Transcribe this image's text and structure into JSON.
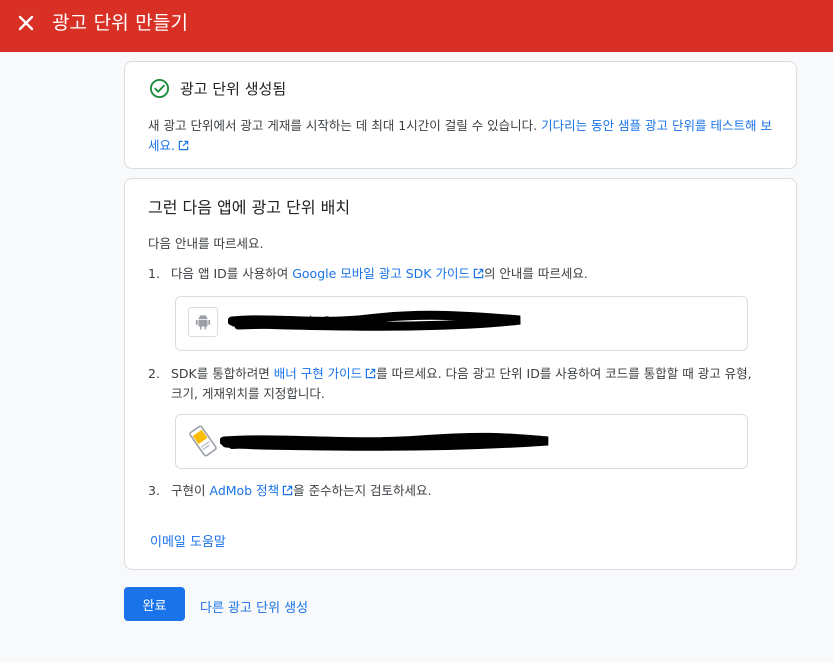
{
  "header": {
    "title": "광고 단위 만들기",
    "close_icon": "close-icon",
    "bg_color": "#d93025"
  },
  "created_card": {
    "status_icon": "check-circle-icon",
    "title": "광고 단위 생성됨",
    "body_text": "새 광고 단위에서 광고 게재를 시작하는 데 최대 1시간이 걸릴 수 있습니다. ",
    "body_link": "기다리는 동안 샘플 광고 단위를 테스트해 보세요."
  },
  "place_card": {
    "title": "그런 다음 앱에 광고 단위 배치",
    "intro": "다음 안내를 따르세요.",
    "step1": {
      "num": "1.",
      "pre": "다음 앱 ID를 사용하여 ",
      "link": "Google 모바일 광고 SDK 가이드",
      "post": "의 안내를 따르세요."
    },
    "app_id": {
      "icon": "android-icon",
      "value": "ca-app-pub-3"
    },
    "step2": {
      "num": "2.",
      "pre": "SDK를 통합하려면 ",
      "link": "배너 구현 가이드",
      "post": "를 따르세요. 다음 광고 단위 ID를 사용하여 코드를 통합할 때 광고 유형, 크기, 게재위치를 지정합니다."
    },
    "ad_unit_id": {
      "icon": "banner-ad-unit-icon"
    },
    "step3": {
      "num": "3.",
      "pre": "구현이 ",
      "link": "AdMob 정책",
      "post": "을 준수하는지 검토하세요."
    },
    "email_help": "이메일 도움말"
  },
  "footer": {
    "done_label": "완료",
    "another_label": "다른 광고 단위 생성"
  },
  "colors": {
    "accent": "#1a73e8",
    "success": "#1e8e3e"
  }
}
